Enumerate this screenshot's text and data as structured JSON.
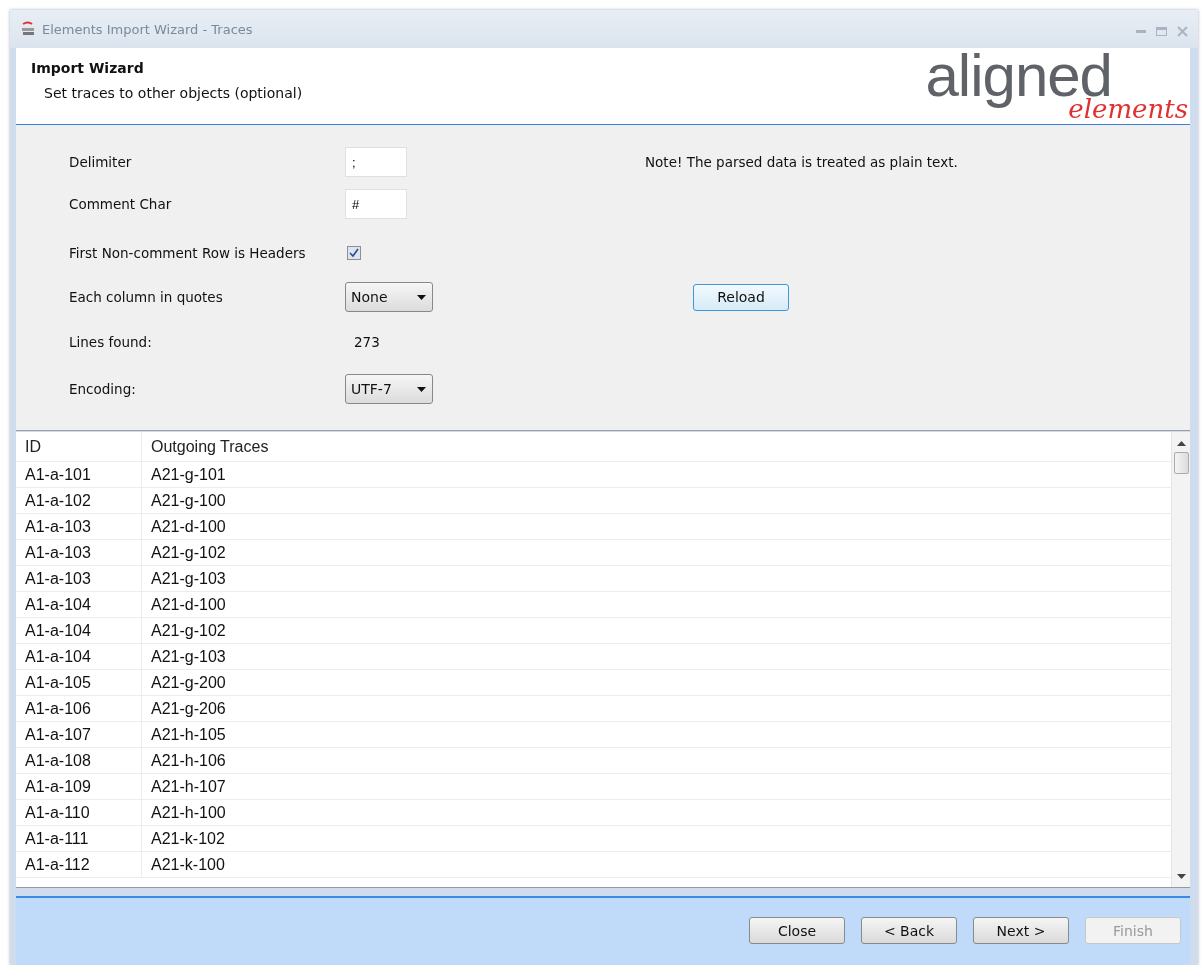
{
  "window": {
    "title": "Elements Import Wizard - Traces"
  },
  "header": {
    "title": "Import Wizard",
    "subtitle": "Set traces to other objects (optional)",
    "logo": {
      "main": "aligned",
      "sub": "elements"
    }
  },
  "form": {
    "delimiter": {
      "label": "Delimiter",
      "value": ";"
    },
    "comment_char": {
      "label": "Comment Char",
      "value": "#"
    },
    "headers": {
      "label": "First Non-comment Row is Headers",
      "checked": true
    },
    "quotes": {
      "label": "Each column in quotes",
      "value": "None"
    },
    "lines_found": {
      "label": "Lines found:",
      "value": "273"
    },
    "encoding": {
      "label": "Encoding:",
      "value": "UTF-7"
    },
    "note": "Note! The parsed data is treated as plain text.",
    "reload_button": "Reload"
  },
  "table": {
    "columns": [
      "ID",
      "Outgoing Traces"
    ],
    "rows": [
      [
        "A1-a-101",
        "A21-g-101"
      ],
      [
        "A1-a-102",
        "A21-g-100"
      ],
      [
        "A1-a-103",
        "A21-d-100"
      ],
      [
        "A1-a-103",
        "A21-g-102"
      ],
      [
        "A1-a-103",
        "A21-g-103"
      ],
      [
        "A1-a-104",
        "A21-d-100"
      ],
      [
        "A1-a-104",
        "A21-g-102"
      ],
      [
        "A1-a-104",
        "A21-g-103"
      ],
      [
        "A1-a-105",
        "A21-g-200"
      ],
      [
        "A1-a-106",
        "A21-g-206"
      ],
      [
        "A1-a-107",
        "A21-h-105"
      ],
      [
        "A1-a-108",
        "A21-h-106"
      ],
      [
        "A1-a-109",
        "A21-h-107"
      ],
      [
        "A1-a-110",
        "A21-h-100"
      ],
      [
        "A1-a-111",
        "A21-k-102"
      ],
      [
        "A1-a-112",
        "A21-k-100"
      ]
    ]
  },
  "buttons": [
    {
      "label": "Close",
      "disabled": false
    },
    {
      "label": "< Back",
      "disabled": false
    },
    {
      "label": "Next >",
      "disabled": false
    },
    {
      "label": "Finish",
      "disabled": true
    }
  ]
}
